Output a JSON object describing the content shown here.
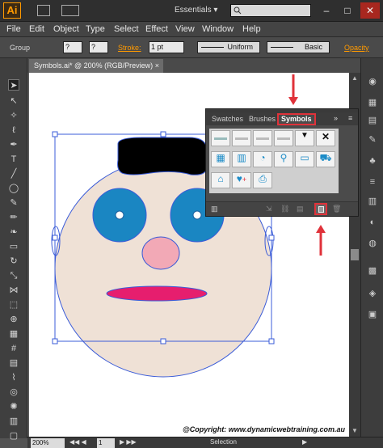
{
  "app": {
    "logo": "Ai",
    "workspace": "Essentials",
    "workspace_arrow": "▾"
  },
  "window_buttons": {
    "minimize": "–",
    "maximize": "□",
    "close": "✕"
  },
  "menu": [
    "File",
    "Edit",
    "Object",
    "Type",
    "Select",
    "Effect",
    "View",
    "Window",
    "Help"
  ],
  "control_bar": {
    "selection_label": "Group",
    "stroke_label": "Stroke:",
    "stroke_weight": "1 pt",
    "profile": "Uniform",
    "brush": "Basic",
    "opacity_label": "Opacity"
  },
  "document": {
    "tab_title": "Symbols.ai* @ 200% (RGB/Preview)",
    "tab_close": "×"
  },
  "symbols_panel": {
    "tabs": [
      "Swatches",
      "Brushes",
      "Symbols"
    ],
    "active_tab": "Symbols",
    "menu_glyph": "≡",
    "collapse_glyph": "»",
    "symbols": [
      "bar-1",
      "bar-2",
      "bar-3",
      "bar-4",
      "dropdown-arrow",
      "close-x",
      "calendar",
      "film-strip",
      "rss-feed",
      "magnifier",
      "credit-card",
      "shopping-cart",
      "home",
      "heart-plus",
      "printer"
    ],
    "highlight_color": "#e0323a"
  },
  "artwork": {
    "face_color": "#efe1d6",
    "hair_color": "#000000",
    "eye_color": "#1a86c2",
    "nose_color": "#f2a9b6",
    "mouth_color": "#e61e6e",
    "selection_color": "#3b5cd8"
  },
  "copyright": "@Copyright: www.dynamicwebtraining.com.au",
  "status_bar": {
    "zoom": "200%",
    "artboard": "1",
    "mode": "Selection"
  }
}
